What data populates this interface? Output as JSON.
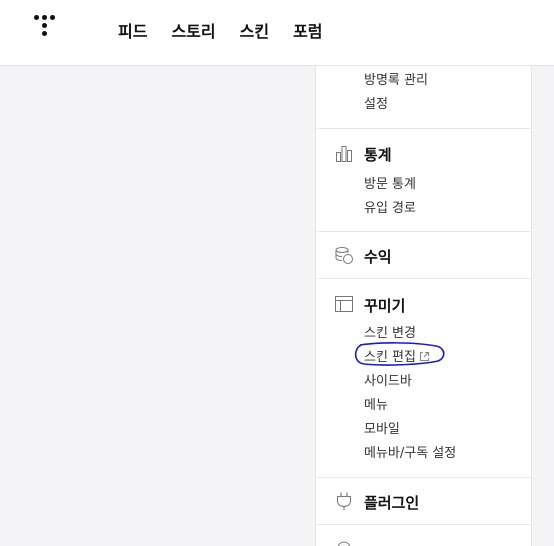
{
  "nav": {
    "items": [
      "피드",
      "스토리",
      "스킨",
      "포럼"
    ]
  },
  "sidebar": {
    "sections": [
      {
        "id": "top-partial",
        "title": "",
        "icon": "",
        "items": [
          "방명록 관리",
          "설정"
        ]
      },
      {
        "id": "stats",
        "title": "통계",
        "icon": "bar-chart-icon",
        "items": [
          "방문 통계",
          "유입 경로"
        ]
      },
      {
        "id": "revenue",
        "title": "수익",
        "icon": "coins-icon",
        "items": []
      },
      {
        "id": "decorate",
        "title": "꾸미기",
        "icon": "layout-icon",
        "items": [
          "스킨 변경",
          "스킨 편집",
          "사이드바",
          "메뉴",
          "모바일",
          "메뉴바/구독 설정"
        ]
      },
      {
        "id": "plugin",
        "title": "플러그인",
        "icon": "plug-icon",
        "items": []
      }
    ]
  },
  "colors": {
    "highlight_circle": "#1a1acc"
  }
}
